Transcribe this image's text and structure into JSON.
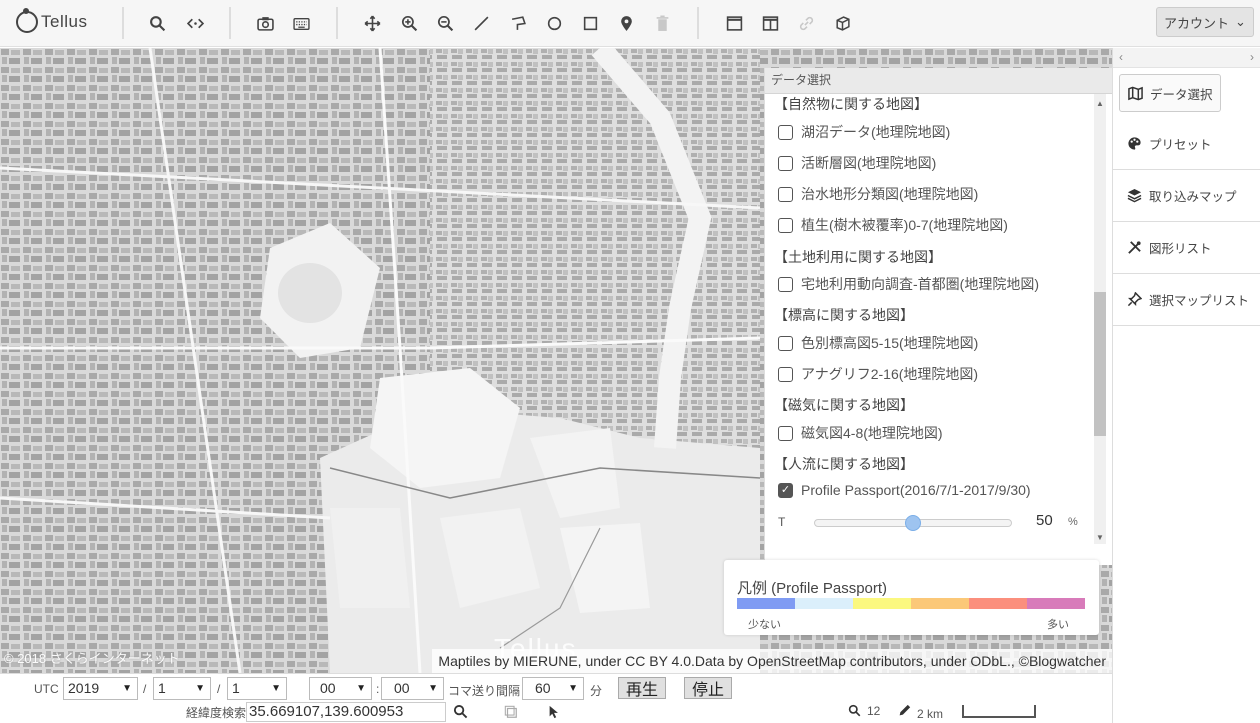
{
  "app": {
    "logo_text": "Tellus"
  },
  "toolbar": {
    "account_label": "アカウント"
  },
  "panel": {
    "title": "データ選択",
    "categories": [
      {
        "label": "【自然物に関する地図】"
      },
      {
        "label": "【土地利用に関する地図】"
      },
      {
        "label": "【標高に関する地図】"
      },
      {
        "label": "【磁気に関する地図】"
      },
      {
        "label": "【人流に関する地図】"
      }
    ],
    "items": [
      {
        "label": "湖沼データ(地理院地図)",
        "checked": false
      },
      {
        "label": "活断層図(地理院地図)",
        "checked": false
      },
      {
        "label": "治水地形分類図(地理院地図)",
        "checked": false
      },
      {
        "label": "植生(樹木被覆率)0-7(地理院地図)",
        "checked": false
      },
      {
        "label": "宅地利用動向調査-首都圏(地理院地図)",
        "checked": false
      },
      {
        "label": "色別標高図5-15(地理院地図)",
        "checked": false
      },
      {
        "label": "アナグリフ2-16(地理院地図)",
        "checked": false
      },
      {
        "label": "磁気図4-8(地理院地図)",
        "checked": false
      },
      {
        "label": "Profile Passport(2016/7/1-2017/9/30)",
        "checked": true
      }
    ],
    "transparency": {
      "label": "T",
      "value": "50",
      "unit": "%",
      "fraction": 0.5
    },
    "scroll": {
      "position": 0.66,
      "visible_fraction": 0.34
    }
  },
  "legend": {
    "title": "凡例 (Profile Passport)",
    "low_label": "少ない",
    "high_label": "多い",
    "colors": [
      "#7f9bf3",
      "#dbeffb",
      "#fbf87f",
      "#fbc878",
      "#fb8f7d",
      "#d87bba"
    ]
  },
  "map": {
    "attribution": "Maptiles by MIERUNE, under CC BY 4.0.Data by OpenStreetMap contributors, under ODbL., ©Blogwatcher",
    "copyright": "© 2018 さくらインターネット",
    "watermark": "Tellus"
  },
  "sidebar": {
    "arrow_left": "‹",
    "arrow_right": "›",
    "items": [
      {
        "label": "データ選択",
        "icon": "map-icon"
      },
      {
        "label": "プリセット",
        "icon": "palette-icon"
      },
      {
        "label": "取り込みマップ",
        "icon": "layers-icon"
      },
      {
        "label": "図形リスト",
        "icon": "tools-icon"
      },
      {
        "label": "選択マップリスト",
        "icon": "pin-icon"
      }
    ]
  },
  "timebar": {
    "utc_label": "UTC",
    "year": "2019",
    "month": "1",
    "day": "1",
    "hour": "00",
    "minute": "00",
    "slash": "/",
    "colon": ":",
    "frame_label": "コマ送り間隔",
    "frame_value": "60",
    "frame_unit": "分",
    "play_label": "再生",
    "stop_label": "停止"
  },
  "coordbar": {
    "search_label": "経緯度検索",
    "coordinates": "35.669107,139.600953",
    "zoom": "12",
    "scale": "2 km"
  }
}
